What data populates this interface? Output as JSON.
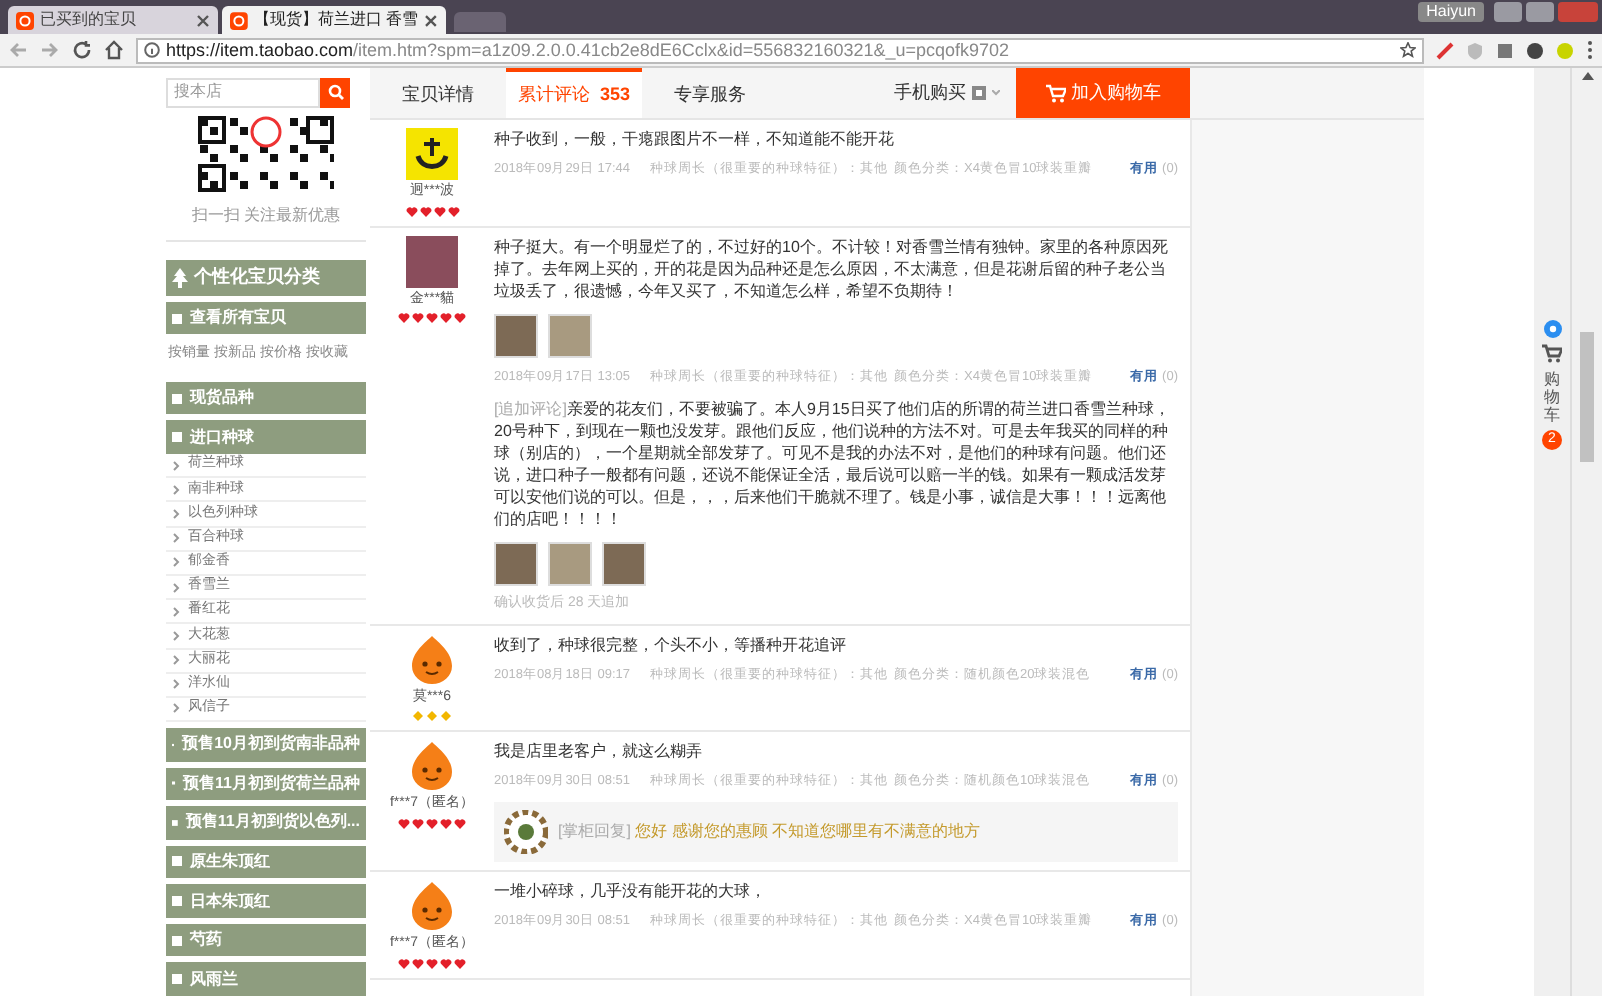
{
  "browser": {
    "tabs": [
      {
        "title": "已买到的宝贝",
        "selected": false
      },
      {
        "title": "【现货】荷兰进口 香雪",
        "selected": true
      }
    ],
    "window_user": "Haiyun",
    "url_host": "https://item.taobao.com",
    "url_path": "/item.htm?spm=a1z09.2.0.0.41cb2e8dE6Cclx&id=556832160321&_u=pcqofk9702"
  },
  "shop_nav": {
    "search_placeholder": "搜本店",
    "tabs": [
      {
        "label": "宝贝详情",
        "selected": false
      },
      {
        "label": "累计评论",
        "count": "353",
        "selected": true
      },
      {
        "label": "专享服务",
        "selected": false
      }
    ],
    "mobile_buy": "手机购买",
    "cart_button": "加入购物车"
  },
  "sidebar": {
    "qr_caption": "扫一扫 关注最新优惠",
    "category_title": "个性化宝贝分类",
    "sections": [
      {
        "label": "查看所有宝贝",
        "links": [
          "按销量",
          "按新品",
          "按价格",
          "按收藏"
        ]
      },
      {
        "label": "现货品种"
      },
      {
        "label": "进口种球",
        "children": [
          "荷兰种球",
          "南非种球",
          "以色列种球",
          "百合种球",
          "郁金香",
          "香雪兰",
          "番红花",
          "大花葱",
          "大丽花",
          "洋水仙",
          "风信子"
        ]
      },
      {
        "label": "预售10月初到货南非品种"
      },
      {
        "label": "预售11月初到货荷兰品种"
      },
      {
        "label": "预售11月初到货以色列..."
      },
      {
        "label": "原生朱顶红"
      },
      {
        "label": "日本朱顶红"
      },
      {
        "label": "芍药"
      },
      {
        "label": "风雨兰"
      }
    ]
  },
  "reviews": [
    {
      "avatar": {
        "kind": "logo"
      },
      "user": "迥***波",
      "rank": {
        "kind": "heart",
        "stars": 4
      },
      "text": "种子收到，一般，干瘪跟图片不一样，不知道能不能开花",
      "date": "2018年09月29日 17:44",
      "spec": "种球周长（很重要的种球特征）：其他",
      "variant": "颜色分类：X4黄色冒10球装重瓣",
      "useful": "有用",
      "useful_count": "(0)"
    },
    {
      "avatar": {
        "kind": "photo"
      },
      "user": "金***貓",
      "rank": {
        "kind": "heart",
        "stars": 5
      },
      "text": "种子挺大。有一个明显烂了的，不过好的10个。不计较！对香雪兰情有独钟。家里的各种原因死掉了。去年网上买的，开的花是因为品种还是怎么原因，不太满意，但是花谢后留的种子老公当垃圾丢了，很遗憾，今年又买了，不知道怎么样，希望不负期待！",
      "photos": [
        {
          "kind": "photo"
        },
        {
          "kind": "photo"
        }
      ],
      "date": "2018年09月17日 13:05",
      "spec": "种球周长（很重要的种球特征）：其他",
      "variant": "颜色分类：X4黄色冒10球装重瓣",
      "useful": "有用",
      "useful_count": "(0)",
      "append": {
        "label": "[追加评论]",
        "text": "亲爱的花友们，不要被骗了。本人9月15日买了他们店的所谓的荷兰进口香雪兰种球，20号种下，到现在一颗也没发芽。跟他们反应，他们说种的方法不对。可是去年我买的同样的种球（别店的），一个星期就全部发芽了。可见不是我的办法不对，是他们的种球有问题。他们还说，进口种子一般都有问题，还说不能保证全活，最后说可以赔一半的钱。如果有一颗成活发芽可以安他们说的可以。但是，，，后来他们干脆就不理了。钱是小事，诚信是大事！！！远离他们的店吧！！！！",
        "photos": [
          {
            "kind": "photo"
          },
          {
            "kind": "photo"
          },
          {
            "kind": "photo"
          }
        ],
        "note": "确认收货后 28 天追加"
      }
    },
    {
      "avatar": {
        "kind": "cartoon"
      },
      "user": "莫***6",
      "rank": {
        "kind": "diamond",
        "stars": 3
      },
      "text": "收到了，种球很完整，个头不小，等播种开花追评",
      "date": "2018年08月18日 09:17",
      "spec": "种球周长（很重要的种球特征）：其他",
      "variant": "颜色分类：随机颜色20球装混色",
      "useful": "有用",
      "useful_count": "(0)"
    },
    {
      "avatar": {
        "kind": "cartoon"
      },
      "user": "f***7（匿名）",
      "rank": {
        "kind": "heart",
        "stars": 5
      },
      "text": "我是店里老客户，就这么糊弄",
      "date": "2018年09月30日 08:51",
      "spec": "种球周长（很重要的种球特征）：其他",
      "variant": "颜色分类：随机颜色10球装混色",
      "useful": "有用",
      "useful_count": "(0)",
      "reply": {
        "label": "[掌柜回复]",
        "text": "您好 感谢您的惠顾 不知道您哪里有不满意的地方"
      }
    },
    {
      "avatar": {
        "kind": "cartoon"
      },
      "user": "f***7（匿名）",
      "rank": {
        "kind": "heart",
        "stars": 5
      },
      "text": "一堆小碎球，几乎没有能开花的大球，",
      "date": "2018年09月30日 08:51",
      "spec": "种球周长（很重要的种球特征）：其他",
      "variant": "颜色分类：X4黄色冒10球装重瓣",
      "useful": "有用",
      "useful_count": "(0)"
    }
  ],
  "floating": {
    "cart_label": "购物车",
    "cart_count": "2"
  }
}
